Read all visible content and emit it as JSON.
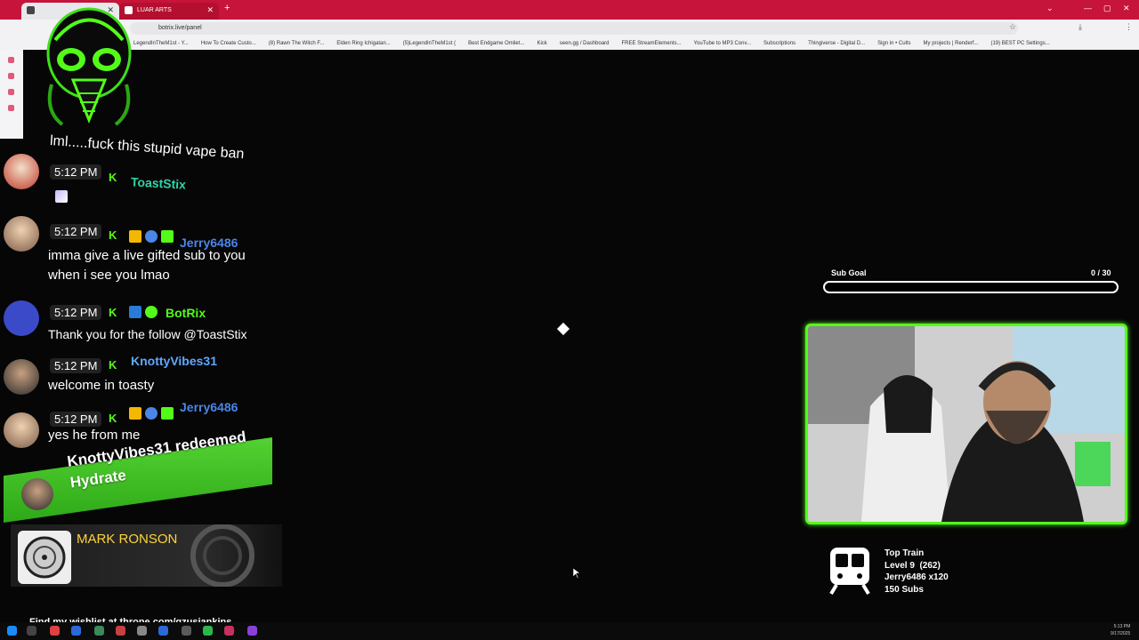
{
  "browser": {
    "tabs": [
      {
        "label": ""
      },
      {
        "label": "LUAR ARTS"
      }
    ],
    "url": "botrix.live/panel",
    "bookmarks": [
      "LegendInTheM1st - Y...",
      "How To Create Custo...",
      "(8) Rawn The Witch F...",
      "Elden Ring Ichigatan...",
      "(5)LegendInTheM1st (",
      "Best Endgame Omilet...",
      "Kick",
      "seen.gg / Dashboard",
      "FREE StreamElements...",
      "YouTube to MP3 Conv...",
      "Subscriptions",
      "Thingiverse - Digital D...",
      "Sign in • Cults",
      "My projects | Renderf...",
      "(19) BEST PC Settings..."
    ]
  },
  "chat": {
    "header_text": "lml.....fuck this stupid vape ban",
    "messages": [
      {
        "time": "5:12 PM",
        "username": "ToastStix",
        "text": ""
      },
      {
        "time": "5:12 PM",
        "username": "Jerry6486",
        "text": "imma give a live gifted sub to you when i see you lmao"
      },
      {
        "time": "5:12 PM",
        "username": "BotRix",
        "text": "Thank you for the follow @ToastStix"
      },
      {
        "time": "5:12 PM",
        "username": "KnottyVibes31",
        "text": "welcome in toasty"
      },
      {
        "time": "5:12 PM",
        "username": "Jerry6486",
        "text": "yes he from me"
      }
    ],
    "redeem": {
      "line1": "KnottyVibes31 redeemed",
      "line2": "Hydrate"
    },
    "colors": {
      "toaststix": "#2dd4a8",
      "jerry": "#4a86e8",
      "botrix": "#53fc18",
      "knotty": "#5fa8ff"
    }
  },
  "now_playing": {
    "artist": "MARK RONSON"
  },
  "wishlist": "Find my wishlist at throne.com/gzusjankins",
  "sub_goal": {
    "label": "Sub Goal",
    "count": "0 / 30",
    "progress": 0
  },
  "top_train": {
    "title": "Top Train",
    "level": "Level 9  (262)",
    "user": "Jerry6486 x120",
    "subs": "150 Subs"
  },
  "clock": {
    "time": "5:13 PM",
    "date": "9/17/2025"
  }
}
